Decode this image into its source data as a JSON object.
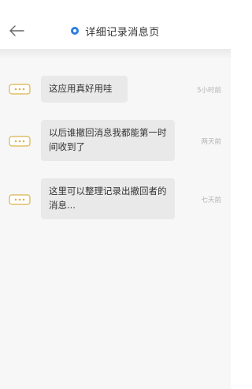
{
  "header": {
    "title": "详细记录消息页"
  },
  "messages": [
    {
      "text": "这应用真好用哇",
      "time": "5小时前"
    },
    {
      "text": "以后谁撤回消息我都能第一时间收到了",
      "time": "两天前"
    },
    {
      "text": "这里可以整理记录出撤回者的消息...",
      "time": "七天前"
    }
  ],
  "colors": {
    "accent": "#2f7de1",
    "bubble": "#e9e9e9",
    "icon": "#d9b34a"
  },
  "icons": {
    "back": "back-arrow-icon",
    "title": "ring-icon",
    "message": "message-bubble-icon"
  }
}
